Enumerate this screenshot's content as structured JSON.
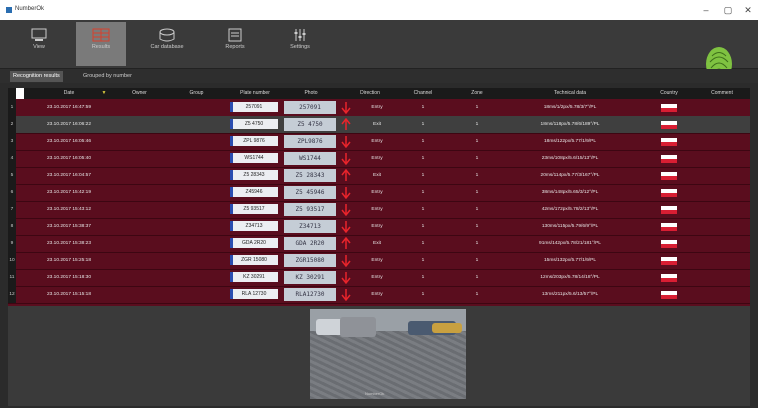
{
  "window": {
    "title": "NumberOk",
    "buttons": [
      "–",
      "▢",
      "✕"
    ]
  },
  "ribbon": [
    {
      "label": "View",
      "icon": "view-icon",
      "active": false
    },
    {
      "label": "Results",
      "icon": "results-icon",
      "active": true
    },
    {
      "label": "Car database",
      "icon": "car-database-icon",
      "active": false
    },
    {
      "label": "Reports",
      "icon": "reports-icon",
      "active": false
    },
    {
      "label": "Settings",
      "icon": "settings-icon",
      "active": false
    }
  ],
  "tabs": [
    {
      "label": "Recognition results",
      "active": true
    },
    {
      "label": "Grouped by number",
      "active": false
    }
  ],
  "columns": [
    "Date",
    "Owner",
    "Group",
    "Plate number",
    "Photo",
    "Direction",
    "Channel",
    "Zone",
    "Technical data",
    "Country",
    "Comment"
  ],
  "rows": [
    {
      "idx": "1",
      "date": "23.10.2017 16:47:59",
      "plate": "257091",
      "photo": "257091",
      "direction": "Entry",
      "channel": "1",
      "zone": "1",
      "tech": "18ms/1/2px/5.78/3/7°/PL",
      "country": "PL",
      "selected": false
    },
    {
      "idx": "2",
      "date": "23.10.2017 16:06:22",
      "plate": "Z5  4750",
      "photo": "Z5 4750",
      "direction": "Exit",
      "channel": "1",
      "zone": "1",
      "tech": "18ms/118px/5.78/6/189°/PL",
      "country": "PL",
      "selected": true
    },
    {
      "idx": "3",
      "date": "23.10.2017 16:05:46",
      "plate": "ZPL  9876",
      "photo": "ZPL9876",
      "direction": "Entry",
      "channel": "1",
      "zone": "1",
      "tech": "18ms/122px/5.77/1/9/PL",
      "country": "PL",
      "selected": false
    },
    {
      "idx": "4",
      "date": "23.10.2017 16:05:40",
      "plate": "WS1744",
      "photo": "WS1744",
      "direction": "Entry",
      "channel": "1",
      "zone": "1",
      "tech": "23ms/108px/5.6/15/13°/PL",
      "country": "PL",
      "selected": false
    },
    {
      "idx": "5",
      "date": "23.10.2017 16:04:57",
      "plate": "Z5  28343",
      "photo": "Z5 28343",
      "direction": "Exit",
      "channel": "1",
      "zone": "1",
      "tech": "20ms/114px/5.77/3/167°/PL",
      "country": "PL",
      "selected": false
    },
    {
      "idx": "6",
      "date": "23.10.2017 15:42:19",
      "plate": "Z45946",
      "photo": "Z5 45946",
      "direction": "Entry",
      "channel": "1",
      "zone": "1",
      "tech": "38ms/148px/5.65/3/12°/PL",
      "country": "PL",
      "selected": false
    },
    {
      "idx": "7",
      "date": "23.10.2017 15:43:12",
      "plate": "Z5  93517",
      "photo": "Z5 93517",
      "direction": "Entry",
      "channel": "1",
      "zone": "1",
      "tech": "42ms/172px/5.78/2/13°/PL",
      "country": "PL",
      "selected": false
    },
    {
      "idx": "8",
      "date": "23.10.2017 15:38:37",
      "plate": "Z34713",
      "photo": "Z34713",
      "direction": "Entry",
      "channel": "1",
      "zone": "1",
      "tech": "130ms/115px/5.79/6/9°/PL",
      "country": "PL",
      "selected": false
    },
    {
      "idx": "9",
      "date": "23.10.2017 15:38:23",
      "plate": "GDA  2R20",
      "photo": "GDA 2R20",
      "direction": "Exit",
      "channel": "1",
      "zone": "1",
      "tech": "91ms/142px/5.78/21/181°/PL",
      "country": "PL",
      "selected": false
    },
    {
      "idx": "10",
      "date": "23.10.2017 15:25:18",
      "plate": "ZGR  15080",
      "photo": "ZGR15080",
      "direction": "Entry",
      "channel": "1",
      "zone": "1",
      "tech": "15ms/132px/5.77/1/9/PL",
      "country": "PL",
      "selected": false
    },
    {
      "idx": "11",
      "date": "23.10.2017 15:18:30",
      "plate": "KZ  30291",
      "photo": "KZ 30291",
      "direction": "Entry",
      "channel": "1",
      "zone": "1",
      "tech": "12ms/203px/5.78/14/18°/PL",
      "country": "PL",
      "selected": false
    },
    {
      "idx": "12",
      "date": "23.10.2017 15:15:18",
      "plate": "RLA  12730",
      "photo": "RLA12730",
      "direction": "Entry",
      "channel": "1",
      "zone": "1",
      "tech": "13ms/211px/5.6/13/57°/PL",
      "country": "PL",
      "selected": false
    }
  ],
  "colors": {
    "row_bg": "#5a0d1e",
    "selected_bg": "#3f3f3f",
    "arrow": "#e8242b",
    "accent_green": "#7fc241"
  },
  "camera": {
    "watermark": "NumberOk"
  }
}
